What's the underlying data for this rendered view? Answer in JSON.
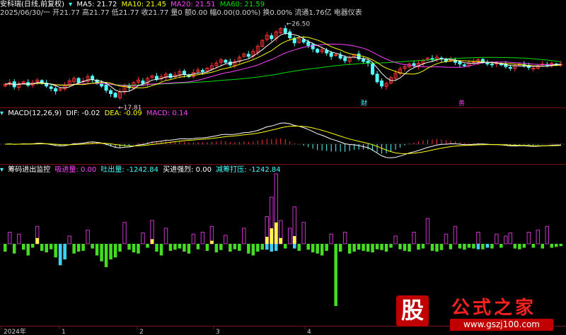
{
  "chart_data": {
    "type": "candlestick",
    "title": "安科瑞(日线,前复权)",
    "price_panel": {
      "ma_labels": [
        {
          "name": "MA5",
          "value": "21.72",
          "color": "#ffffff"
        },
        {
          "name": "MA10",
          "value": "21.45",
          "color": "#ffff00"
        },
        {
          "name": "MA20",
          "value": "21.51",
          "color": "#ff40ff"
        },
        {
          "name": "MA60",
          "value": "21.59",
          "color": "#00e000"
        }
      ],
      "info_line": "2025/06/30/一 开21.77 高21.77 低21.77 收21.77 量0 额0.00 幅0.00(0.00%) 换0.00% 流通1.76亿 电器仪表",
      "high_marker": "26.50",
      "low_marker": "17.81",
      "events": [
        "财",
        "务"
      ]
    },
    "macd_panel": {
      "title": "MACD(12,26,9)",
      "dif_label": "DIF: -0.02",
      "dea_label": "DEA: -0.09",
      "macd_label": "MACD: 0.14"
    },
    "chip_panel": {
      "title": "筹码进出监控",
      "labels": [
        {
          "text": "吸进量: 0.00",
          "color": "#ff40ff"
        },
        {
          "text": "吐出量: -1242.84",
          "color": "#40ffff"
        },
        {
          "text": "买进强烈: 0.00",
          "color": "#ffffff"
        },
        {
          "text": "减筹打压: -1242.84",
          "color": "#40ffff"
        }
      ]
    },
    "x_axis": [
      "2024年",
      "1",
      "2",
      "3",
      "4"
    ],
    "close": [
      19.4,
      19.6,
      19.1,
      19.5,
      19.7,
      19.3,
      19.6,
      19.9,
      19.5,
      19.2,
      18.9,
      18.6,
      18.9,
      19.3,
      19.8,
      20.1,
      19.6,
      19.8,
      20.3,
      20.0,
      19.5,
      19.2,
      18.7,
      18.3,
      17.9,
      18.5,
      19.2,
      19.0,
      19.6,
      19.9,
      19.5,
      20.1,
      20.4,
      20.0,
      20.3,
      20.6,
      20.2,
      20.5,
      20.9,
      20.6,
      20.3,
      20.8,
      21.1,
      20.9,
      21.3,
      21.6,
      21.9,
      22.3,
      22.0,
      21.7,
      22.1,
      22.6,
      23.0,
      22.7,
      23.3,
      23.9,
      24.6,
      25.2,
      24.8,
      25.6,
      26.0,
      25.5,
      24.9,
      24.3,
      24.8,
      24.4,
      24.0,
      23.6,
      23.2,
      23.5,
      23.1,
      22.7,
      22.9,
      22.5,
      22.2,
      22.6,
      22.9,
      22.4,
      22.1,
      21.9,
      20.6,
      19.7,
      19.2,
      19.5,
      20.2,
      20.7,
      21.2,
      21.5,
      21.8,
      21.6,
      21.9,
      22.2,
      22.5,
      22.3,
      22.6,
      22.4,
      22.1,
      22.3,
      22.0,
      21.8,
      21.6,
      21.9,
      22.1,
      22.3,
      22.0,
      21.8,
      21.7,
      21.9,
      21.7,
      21.5,
      21.3,
      21.6,
      21.8,
      21.6,
      21.4,
      21.3,
      21.6,
      21.8,
      21.7,
      21.9,
      21.7,
      21.77
    ],
    "vol_in": [
      0,
      30,
      0,
      25,
      0,
      0,
      0,
      45,
      0,
      0,
      0,
      0,
      0,
      0,
      20,
      0,
      0,
      0,
      35,
      0,
      0,
      0,
      0,
      0,
      0,
      0,
      55,
      0,
      0,
      0,
      28,
      0,
      60,
      0,
      0,
      40,
      0,
      0,
      0,
      0,
      0,
      25,
      0,
      30,
      0,
      45,
      0,
      0,
      22,
      0,
      0,
      0,
      40,
      0,
      0,
      0,
      0,
      70,
      120,
      180,
      60,
      0,
      40,
      95,
      0,
      55,
      0,
      0,
      0,
      0,
      0,
      25,
      0,
      0,
      30,
      0,
      0,
      0,
      0,
      0,
      0,
      0,
      0,
      0,
      0,
      20,
      0,
      0,
      0,
      30,
      0,
      0,
      65,
      0,
      0,
      0,
      25,
      0,
      45,
      0,
      0,
      0,
      0,
      30,
      0,
      0,
      0,
      25,
      0,
      20,
      28,
      0,
      0,
      0,
      30,
      0,
      35,
      0,
      45,
      0,
      0,
      0
    ],
    "vol_out": [
      -20,
      0,
      -25,
      0,
      -15,
      -30,
      -10,
      0,
      -18,
      -22,
      -14,
      -35,
      -55,
      -40,
      0,
      -25,
      -20,
      -18,
      0,
      -12,
      -30,
      -45,
      -60,
      -40,
      -35,
      -20,
      0,
      -15,
      -22,
      -25,
      0,
      -10,
      0,
      -20,
      -30,
      0,
      -18,
      -15,
      -12,
      -20,
      -25,
      0,
      -14,
      0,
      -18,
      0,
      -22,
      -16,
      0,
      -20,
      -14,
      -18,
      0,
      -25,
      -30,
      -20,
      -15,
      0,
      0,
      0,
      0,
      -12,
      0,
      0,
      -18,
      0,
      -15,
      -22,
      -25,
      -30,
      -18,
      0,
      -160,
      -20,
      0,
      -25,
      -20,
      -15,
      -18,
      -20,
      -22,
      -14,
      -16,
      -20,
      -10,
      0,
      -14,
      -18,
      -20,
      0,
      -15,
      -12,
      0,
      -18,
      -20,
      -16,
      0,
      -14,
      0,
      -12,
      -15,
      -10,
      -12,
      0,
      -14,
      -10,
      -12,
      0,
      -10,
      0,
      0,
      -12,
      -14,
      -10,
      0,
      -10,
      0,
      -12,
      0,
      -10,
      -8,
      -6
    ],
    "vol_in_strong": [
      0,
      0,
      0,
      0,
      0,
      0,
      0,
      15,
      0,
      0,
      0,
      0,
      0,
      0,
      0,
      0,
      0,
      0,
      0,
      0,
      0,
      0,
      0,
      0,
      0,
      0,
      0,
      0,
      0,
      0,
      0,
      0,
      12,
      0,
      0,
      0,
      0,
      0,
      0,
      0,
      0,
      0,
      0,
      0,
      0,
      8,
      0,
      0,
      0,
      0,
      0,
      0,
      0,
      0,
      0,
      0,
      0,
      18,
      40,
      55,
      15,
      0,
      0,
      20,
      0,
      0,
      0,
      0,
      0,
      0,
      0,
      0,
      0,
      0,
      0,
      0,
      0,
      0,
      0,
      0,
      0,
      0,
      0,
      0,
      0,
      0,
      0,
      0,
      0,
      0,
      0,
      0,
      0,
      0,
      0,
      0,
      0,
      0,
      0,
      0,
      0,
      0,
      0,
      0,
      0,
      0,
      0,
      0,
      0,
      0,
      0,
      0,
      0,
      0,
      0,
      0,
      0,
      0,
      0,
      0,
      0,
      0
    ],
    "vol_out_cyan": [
      0,
      0,
      0,
      0,
      0,
      0,
      0,
      0,
      0,
      0,
      0,
      0,
      -55,
      -40,
      0,
      0,
      0,
      0,
      0,
      0,
      0,
      0,
      0,
      0,
      0,
      0,
      0,
      0,
      0,
      0,
      0,
      0,
      0,
      0,
      0,
      0,
      0,
      0,
      0,
      0,
      0,
      0,
      0,
      0,
      0,
      0,
      0,
      0,
      0,
      0,
      0,
      0,
      0,
      0,
      0,
      0,
      0,
      -15,
      -20,
      -18,
      0,
      0,
      0,
      -12,
      0,
      0,
      0,
      0,
      0,
      0,
      0,
      0,
      0,
      0,
      0,
      0,
      0,
      0,
      0,
      0,
      0,
      0,
      0,
      0,
      0,
      0,
      0,
      0,
      0,
      0,
      0,
      0,
      0,
      0,
      0,
      0,
      0,
      0,
      0,
      0,
      0,
      0,
      0,
      -14,
      0,
      -10,
      0,
      0,
      0,
      0,
      0,
      0,
      0,
      0,
      0,
      0,
      0,
      0,
      0,
      0
    ]
  },
  "watermark": {
    "logo_char": "股",
    "site_name": "公式之家",
    "url": "www.gszj100.com"
  }
}
